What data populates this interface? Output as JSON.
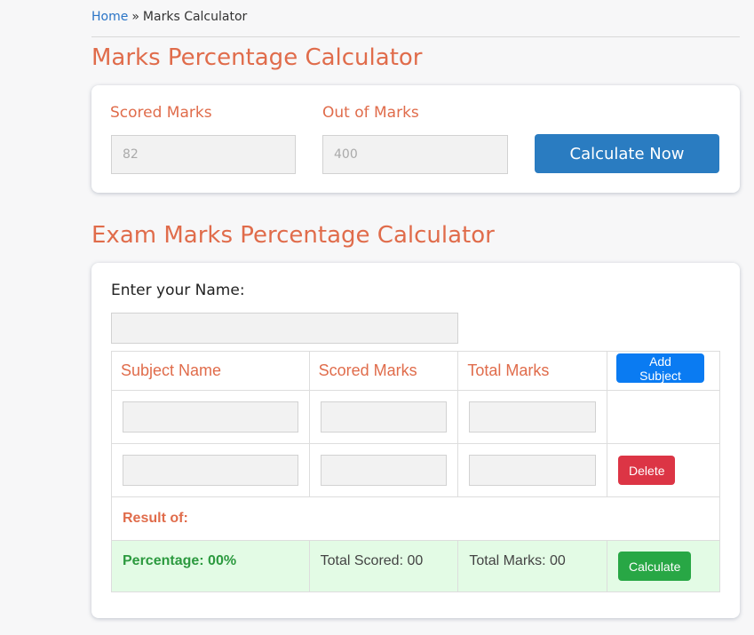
{
  "breadcrumb": {
    "home": "Home",
    "separator": "»",
    "current": "Marks Calculator"
  },
  "simple_calc": {
    "title": "Marks Percentage Calculator",
    "scored_label": "Scored Marks",
    "scored_placeholder": "82",
    "out_of_label": "Out of Marks",
    "out_of_placeholder": "400",
    "button": "Calculate Now"
  },
  "exam_calc": {
    "title": "Exam Marks Percentage Calculator",
    "name_label": "Enter your Name:",
    "name_value": "",
    "columns": [
      "Subject Name",
      "Scored Marks",
      "Total Marks"
    ],
    "add_button": "Add Subject",
    "rows": [
      {
        "subject": "",
        "scored": "",
        "total": "",
        "action": null
      },
      {
        "subject": "",
        "scored": "",
        "total": "",
        "action": "Delete"
      }
    ],
    "result_label": "Result of:",
    "percentage": "Percentage: 00%",
    "total_scored": "Total Scored: 00",
    "total_marks": "Total Marks: 00",
    "calculate_button": "Calculate"
  },
  "colors": {
    "accent": "#e06c4b",
    "link": "#2a74c6",
    "primary_button": "#2a7cc1",
    "add_button": "#0a7bf2",
    "delete_button": "#dc3545",
    "calculate_button": "#28a745",
    "result_row_bg": "#e3fbe5"
  }
}
